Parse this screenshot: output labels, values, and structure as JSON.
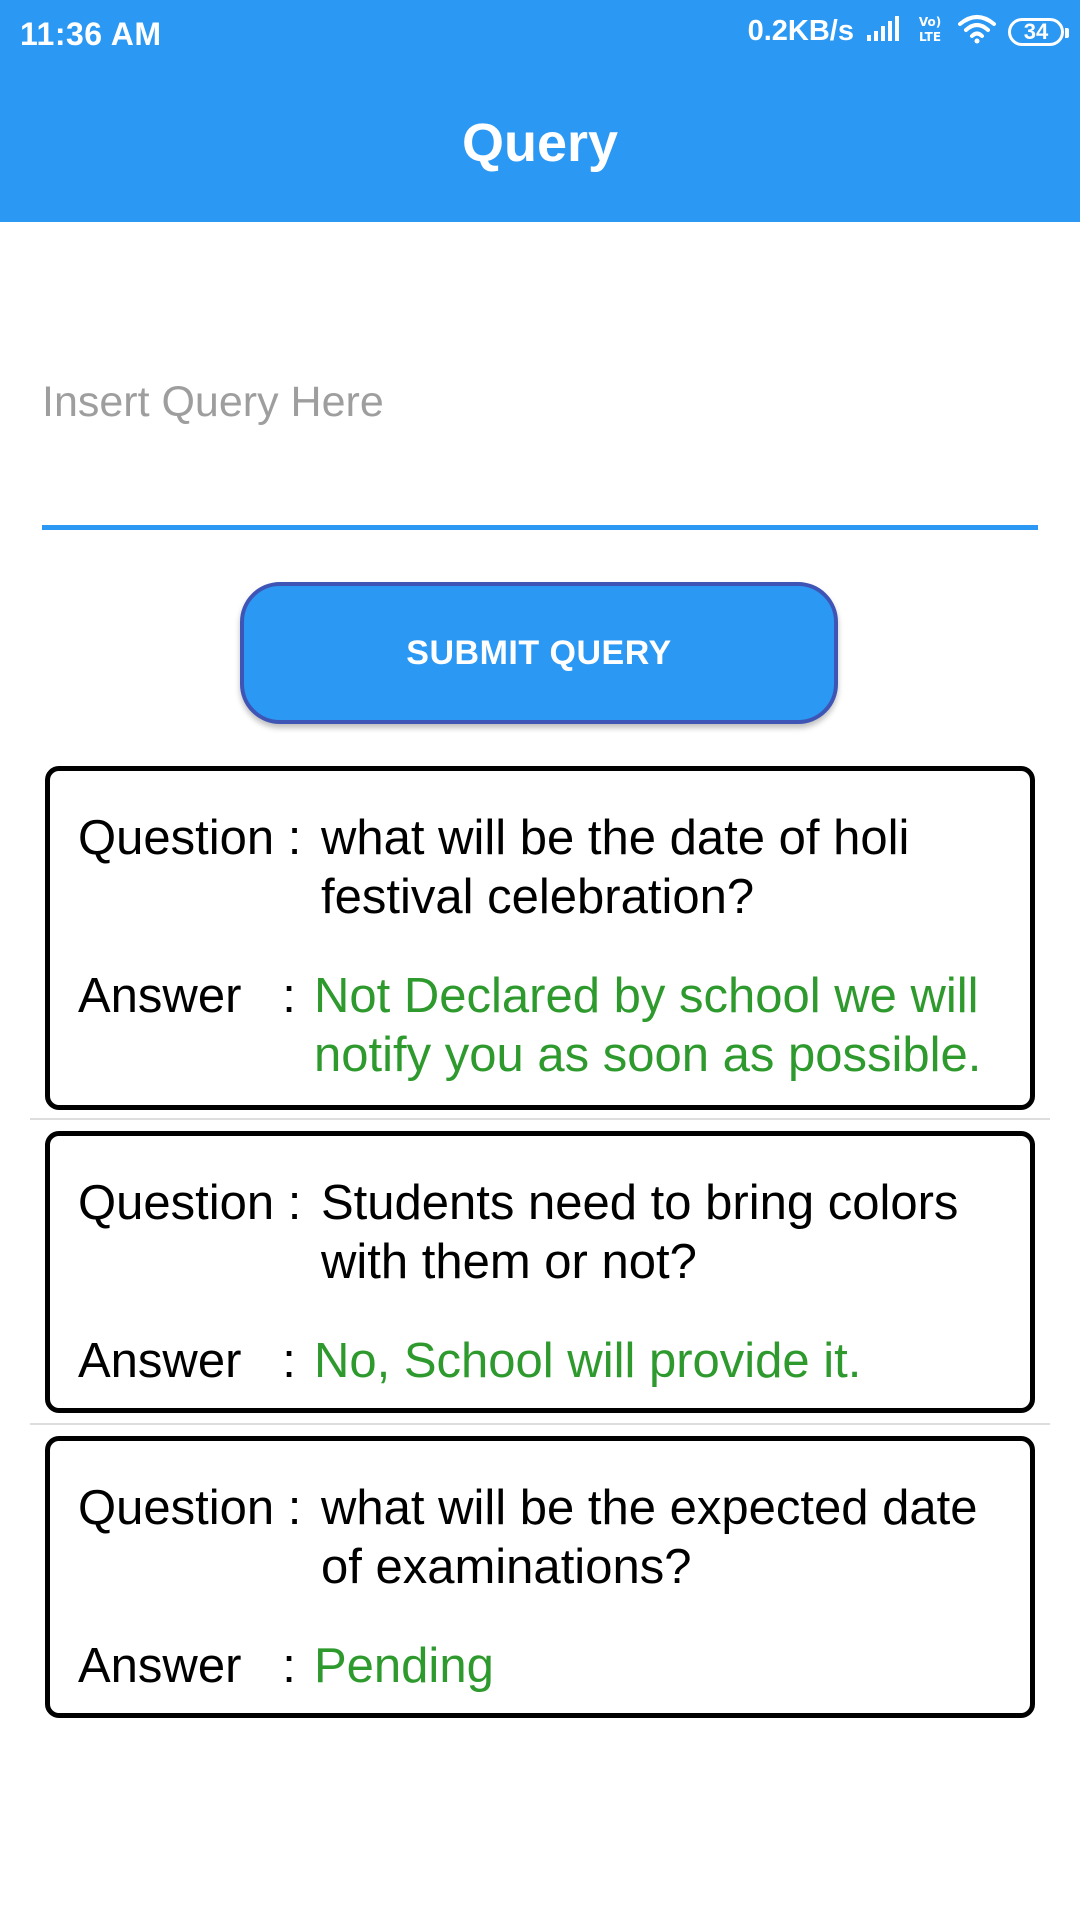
{
  "status_bar": {
    "time": "11:36 AM",
    "network_speed": "0.2KB/s",
    "volte_label": "Vo LTE",
    "battery_level": "34",
    "icons": [
      "signal-icon",
      "volte-icon",
      "wifi-icon",
      "battery-icon"
    ]
  },
  "app_bar": {
    "title": "Query",
    "color": "#2b98f3"
  },
  "query_form": {
    "input_placeholder": "Insert Query Here",
    "input_value": "",
    "submit_label": "SUBMIT QUERY"
  },
  "queries": [
    {
      "question_label": "Question :",
      "question": "what will be the date of holi festival celebration?",
      "answer_label": "Answer   :",
      "answer": "Not Declared by school we will notify you as soon as possible."
    },
    {
      "question_label": "Question :",
      "question": "Students need to bring colors with them or not?",
      "answer_label": "Answer   :",
      "answer": "No, School will provide it."
    },
    {
      "question_label": "Question :",
      "question": "what will be the expected date of examinations?",
      "answer_label": "Answer   :",
      "answer": "Pending"
    }
  ],
  "colors": {
    "primary": "#2b98f3",
    "button_border": "#3f55b5",
    "answer_text": "#2e9a2e",
    "placeholder": "#9e9e9e"
  }
}
